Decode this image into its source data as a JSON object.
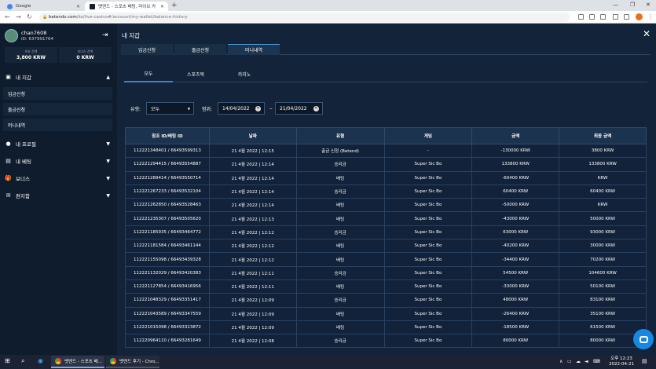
{
  "browser": {
    "tabs": [
      {
        "title": "Google",
        "favicon_color": "#4285f4"
      },
      {
        "title": "벳엔드 - 스포츠 베팅, 라이브 카",
        "favicon_color": "#1a1f2e"
      }
    ],
    "url_domain": "betends.com",
    "url_path": "/ko/live-casino#/account/my-wallet/balance-history"
  },
  "user": {
    "name": "chan7608",
    "id_label": "ID: 637991764",
    "balances": [
      {
        "label": "보유 잔액",
        "value": "3,800 KRW"
      },
      {
        "label": "보너스 잔액",
        "value": "0 KRW"
      }
    ]
  },
  "sidebar": {
    "wallet_label": "내 지갑",
    "wallet_items": [
      "입금신청",
      "출금신청",
      "머니내역"
    ],
    "profile_label": "내 프로필",
    "betting_label": "내 베팅",
    "bonus_label": "보너스",
    "mailbox_label": "편지함"
  },
  "main": {
    "title": "내 지갑",
    "tabs": [
      "입금신청",
      "출금신청",
      "머니내역"
    ],
    "subtabs": [
      "모두",
      "스포츠북",
      "카지노"
    ],
    "filter": {
      "type_label": "유형:",
      "type_value": "모두",
      "range_label": "범위:",
      "date_from": "14/04/2022",
      "date_to": "21/04/2022",
      "dash": "–"
    },
    "columns": [
      "참조 ID/베팅 ID",
      "날짜",
      "유형",
      "게임",
      "금액",
      "최종 금액"
    ],
    "rows": [
      [
        "112221348401 / 66493599313",
        "21 4월 2022 | 12:15",
        "출금 신청 (Betend)",
        "-",
        "-130000 KRW",
        "3800 KRW"
      ],
      [
        "112221294415 / 66493554887",
        "21 4월 2022 | 12:14",
        "승리금",
        "Super Sic Bo",
        "133800 KRW",
        "133800 KRW"
      ],
      [
        "112221289414 / 66493550714",
        "21 4월 2022 | 12:14",
        "배팅",
        "Super Sic Bo",
        "-60400 KRW",
        "KRW"
      ],
      [
        "112221267233 / 66493532104",
        "21 4월 2022 | 12:14",
        "승리금",
        "Super Sic Bo",
        "60400 KRW",
        "60400 KRW"
      ],
      [
        "112221262850 / 66493528463",
        "21 4월 2022 | 12:14",
        "배팅",
        "Super Sic Bo",
        "-50000 KRW",
        "KRW"
      ],
      [
        "112221235307 / 66493505620",
        "21 4월 2022 | 12:13",
        "배팅",
        "Super Sic Bo",
        "-43000 KRW",
        "50000 KRW"
      ],
      [
        "112221185935 / 66493464772",
        "21 4월 2022 | 12:12",
        "승리금",
        "Super Sic Bo",
        "63000 KRW",
        "93000 KRW"
      ],
      [
        "112221181584 / 66493461144",
        "21 4월 2022 | 12:12",
        "배팅",
        "Super Sic Bo",
        "-40200 KRW",
        "30000 KRW"
      ],
      [
        "112221155098 / 66493439328",
        "21 4월 2022 | 12:12",
        "배팅",
        "Super Sic Bo",
        "-34400 KRW",
        "70200 KRW"
      ],
      [
        "112221132029 / 66493420383",
        "21 4월 2022 | 12:11",
        "승리금",
        "Super Sic Bo",
        "54500 KRW",
        "104600 KRW"
      ],
      [
        "112221127854 / 66493416956",
        "21 4월 2022 | 12:11",
        "배팅",
        "Super Sic Bo",
        "-33000 KRW",
        "50100 KRW"
      ],
      [
        "112221048329 / 66493351417",
        "21 4월 2022 | 12:09",
        "승리금",
        "Super Sic Bo",
        "48000 KRW",
        "83100 KRW"
      ],
      [
        "112221043589 / 66493347559",
        "21 4월 2022 | 12:09",
        "배팅",
        "Super Sic Bo",
        "-26400 KRW",
        "35100 KRW"
      ],
      [
        "112221015098 / 66493323872",
        "21 4월 2022 | 12:09",
        "배팅",
        "Super Sic Bo",
        "-18500 KRW",
        "61500 KRW"
      ],
      [
        "112220964110 / 66493281649",
        "21 4월 2022 | 12:08",
        "승리금",
        "Super Sic Bo",
        "80000 KRW",
        "80000 KRW"
      ]
    ]
  },
  "taskbar": {
    "apps": [
      "벳엔드 - 스포츠 베...",
      "벳엔드 후기 - Chro..."
    ],
    "time": "오후 12:23",
    "date": "2022-04-21"
  },
  "colors": {
    "background": "#0f1c2e",
    "panel": "#13243a",
    "accent": "#3a86c8",
    "chat": "#1787e0"
  }
}
